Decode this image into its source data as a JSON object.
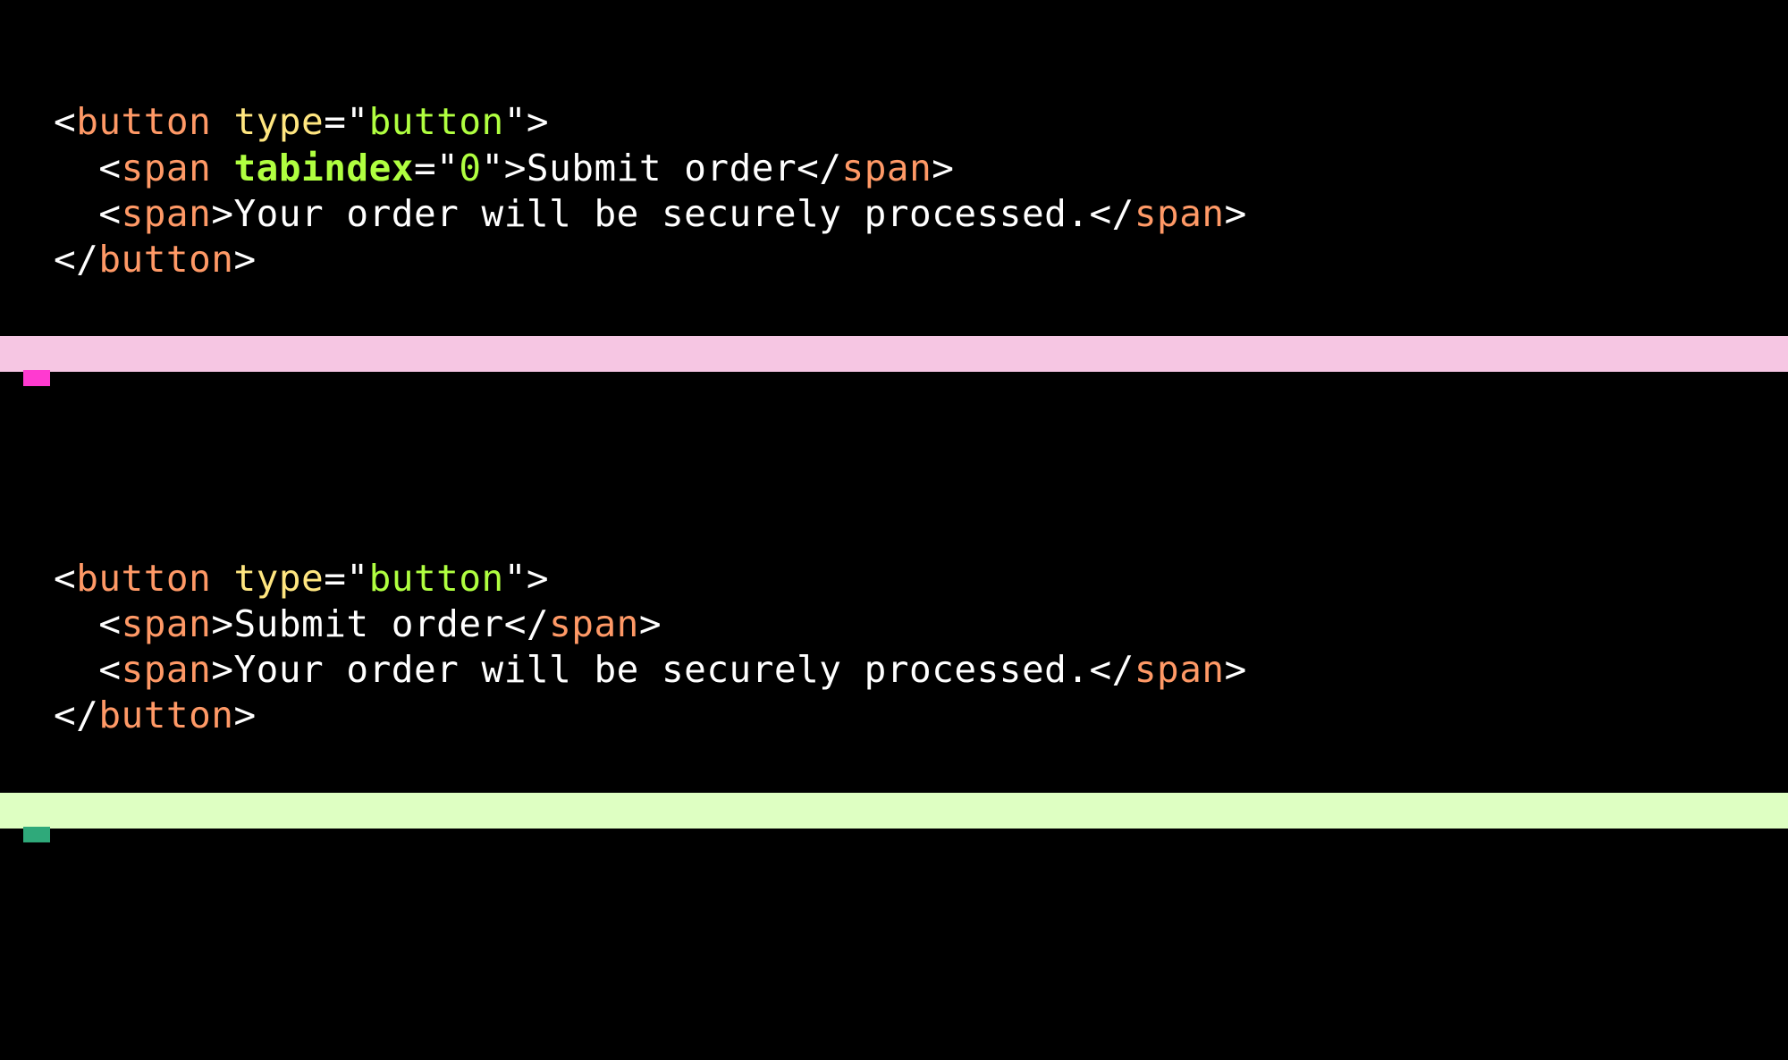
{
  "block1": {
    "line1": {
      "open": "<",
      "tag": "button",
      "space": " ",
      "attr_name": "type",
      "eq": "=",
      "q1": "\"",
      "attr_val": "button",
      "q2": "\"",
      "close": ">"
    },
    "line2": {
      "indent": "  ",
      "open": "<",
      "tag": "span",
      "space": " ",
      "attr_name": "tabindex",
      "eq": "=",
      "q1": "\"",
      "attr_val": "0",
      "q2": "\"",
      "close": ">",
      "text": "Submit order",
      "end_open": "</",
      "end_tag": "span",
      "end_close": ">"
    },
    "line3": {
      "indent": "  ",
      "open": "<",
      "tag": "span",
      "close": ">",
      "text": "Your order will be securely processed.",
      "end_open": "</",
      "end_tag": "span",
      "end_close": ">"
    },
    "line4": {
      "open": "</",
      "tag": "button",
      "close": ">"
    }
  },
  "block2": {
    "line1": {
      "open": "<",
      "tag": "button",
      "space": " ",
      "attr_name": "type",
      "eq": "=",
      "q1": "\"",
      "attr_val": "button",
      "q2": "\"",
      "close": ">"
    },
    "line2": {
      "indent": "  ",
      "open": "<",
      "tag": "span",
      "close": ">",
      "text": "Submit order",
      "end_open": "</",
      "end_tag": "span",
      "end_close": ">"
    },
    "line3": {
      "indent": "  ",
      "open": "<",
      "tag": "span",
      "close": ">",
      "text": "Your order will be securely processed.",
      "end_open": "</",
      "end_tag": "span",
      "end_close": ">"
    },
    "line4": {
      "open": "</",
      "tag": "button",
      "close": ">"
    }
  },
  "colors": {
    "bad_stripe": "#f6c6e3",
    "good_stripe": "#deffc2",
    "bad_flag": "#ff3ad0",
    "good_flag": "#2fa97a"
  }
}
